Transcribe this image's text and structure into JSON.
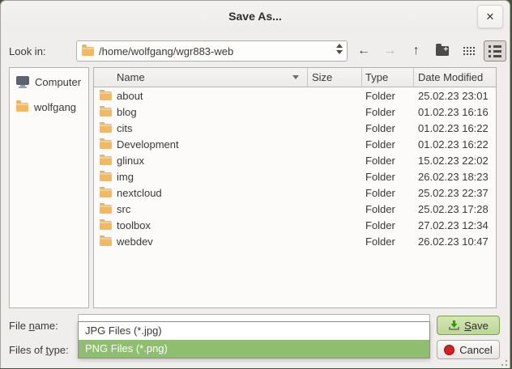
{
  "window": {
    "title": "Save As..."
  },
  "icons": {
    "close": "✕",
    "back": "←",
    "forward": "→",
    "up": "↑"
  },
  "toolbar": {
    "look_in_label": "Look in:",
    "path": "/home/wolfgang/wgr883-web"
  },
  "sidebar": {
    "items": [
      {
        "label": "Computer",
        "icon": "computer-icon"
      },
      {
        "label": "wolfgang",
        "icon": "folder-icon"
      }
    ]
  },
  "table": {
    "headers": [
      "Name",
      "Size",
      "Type",
      "Date Modified"
    ],
    "sort": {
      "column": "Name",
      "direction": "descending"
    },
    "rows": [
      {
        "name": "about",
        "size": "",
        "type": "Folder",
        "date": "25.02.23 23:01"
      },
      {
        "name": "blog",
        "size": "",
        "type": "Folder",
        "date": "01.02.23 16:16"
      },
      {
        "name": "cits",
        "size": "",
        "type": "Folder",
        "date": "01.02.23 16:22"
      },
      {
        "name": "Development",
        "size": "",
        "type": "Folder",
        "date": "01.02.23 16:22"
      },
      {
        "name": "glinux",
        "size": "",
        "type": "Folder",
        "date": "15.02.23 22:02"
      },
      {
        "name": "img",
        "size": "",
        "type": "Folder",
        "date": "26.02.23 18:23"
      },
      {
        "name": "nextcloud",
        "size": "",
        "type": "Folder",
        "date": "25.02.23 22:37"
      },
      {
        "name": "src",
        "size": "",
        "type": "Folder",
        "date": "25.02.23 17:28"
      },
      {
        "name": "toolbox",
        "size": "",
        "type": "Folder",
        "date": "27.02.23 12:34"
      },
      {
        "name": "webdev",
        "size": "",
        "type": "Folder",
        "date": "26.02.23 10:47"
      }
    ]
  },
  "bottom": {
    "file_name_label": {
      "pre": "File ",
      "key": "n",
      "post": "ame:"
    },
    "file_name_value": "",
    "type_label": {
      "pre": "Files of ",
      "key": "t",
      "post": "ype:"
    },
    "type_options": [
      {
        "label": "JPG Files (*.jpg)",
        "selected": false
      },
      {
        "label": "PNG Files (*.png)",
        "selected": true
      }
    ],
    "save_label": {
      "pre": "",
      "key": "S",
      "post": "ave"
    },
    "cancel_label": "Cancel"
  },
  "colors": {
    "accent_green": "#8ebf6e",
    "folder_orange": "#f2b962",
    "cancel_red": "#d71f1f",
    "dialog_bg": "#f0eeec"
  }
}
